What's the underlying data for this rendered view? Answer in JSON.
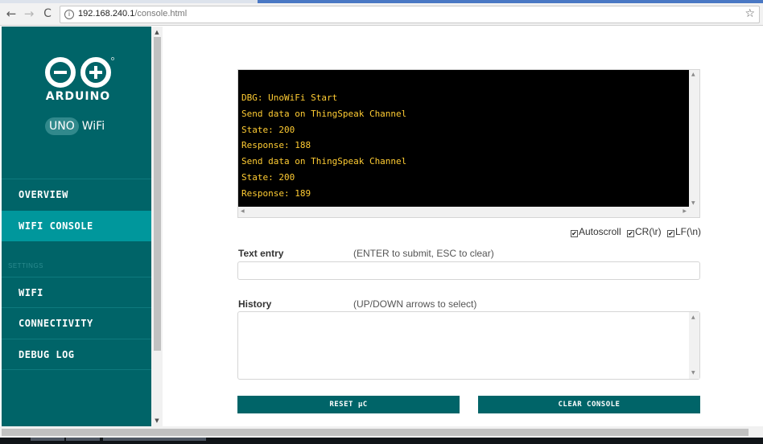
{
  "browser": {
    "url_host": "192.168.240.1",
    "url_path": "/console.html",
    "back_icon": "←",
    "forward_icon": "→",
    "reload_icon": "C",
    "star_icon": "☆"
  },
  "sidebar": {
    "brand": "ARDUINO",
    "board_model": "UNO",
    "board_suffix": "WiFi",
    "section_label": "SETTINGS",
    "items": [
      {
        "label": "OVERVIEW"
      },
      {
        "label": "WIFI CONSOLE"
      },
      {
        "label": "WIFI"
      },
      {
        "label": "CONNECTIVITY"
      },
      {
        "label": "DEBUG LOG"
      }
    ],
    "active_item": "WIFI CONSOLE"
  },
  "console": {
    "lines": [
      "DBG: UnoWiFi Start",
      "Send data on ThingSpeak Channel",
      "State: 200",
      "Response: 188",
      "Send data on ThingSpeak Channel",
      "State: 200",
      "Response: 189"
    ]
  },
  "options": {
    "autoscroll": "Autoscroll",
    "cr": "CR(\\r)",
    "lf": "LF(\\n)",
    "checked_mark": "✔"
  },
  "text_entry": {
    "label": "Text entry",
    "hint": "(ENTER to submit, ESC to clear)",
    "value": ""
  },
  "history": {
    "label": "History",
    "hint": "(UP/DOWN arrows to select)"
  },
  "buttons": {
    "reset": "RESET µC",
    "clear": "CLEAR CONSOLE"
  },
  "colors": {
    "sidebar_bg": "#006468",
    "sidebar_active": "#00979c",
    "console_text": "#ffcc33",
    "console_bg": "#000000"
  }
}
